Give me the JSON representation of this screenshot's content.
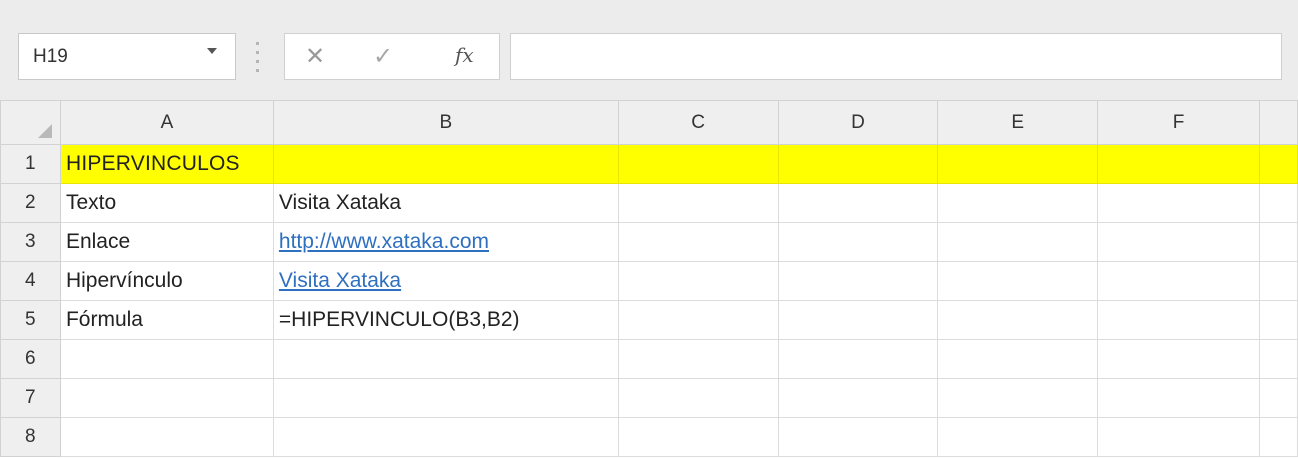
{
  "formula_bar": {
    "name_box": "H19",
    "cancel_icon": "✕",
    "enter_icon": "✓",
    "fx_label": "fx",
    "formula_value": ""
  },
  "columns": [
    "A",
    "B",
    "C",
    "D",
    "E",
    "F",
    ""
  ],
  "rows": [
    {
      "num": "1",
      "cells": [
        "HIPERVINCULOS",
        "",
        "",
        "",
        "",
        "",
        ""
      ]
    },
    {
      "num": "2",
      "cells": [
        "Texto",
        "Visita Xataka",
        "",
        "",
        "",
        "",
        ""
      ]
    },
    {
      "num": "3",
      "cells": [
        "Enlace",
        "http://www.xataka.com",
        "",
        "",
        "",
        "",
        ""
      ]
    },
    {
      "num": "4",
      "cells": [
        "Hipervínculo",
        "Visita Xataka",
        "",
        "",
        "",
        "",
        ""
      ]
    },
    {
      "num": "5",
      "cells": [
        "Fórmula",
        "=HIPERVINCULO(B3,B2)",
        "",
        "",
        "",
        "",
        ""
      ]
    },
    {
      "num": "6",
      "cells": [
        "",
        "",
        "",
        "",
        "",
        "",
        ""
      ]
    },
    {
      "num": "7",
      "cells": [
        "",
        "",
        "",
        "",
        "",
        "",
        ""
      ]
    },
    {
      "num": "8",
      "cells": [
        "",
        "",
        "",
        "",
        "",
        "",
        ""
      ]
    }
  ],
  "colors": {
    "highlight": "#ffff00",
    "link": "#2f6fc0"
  }
}
